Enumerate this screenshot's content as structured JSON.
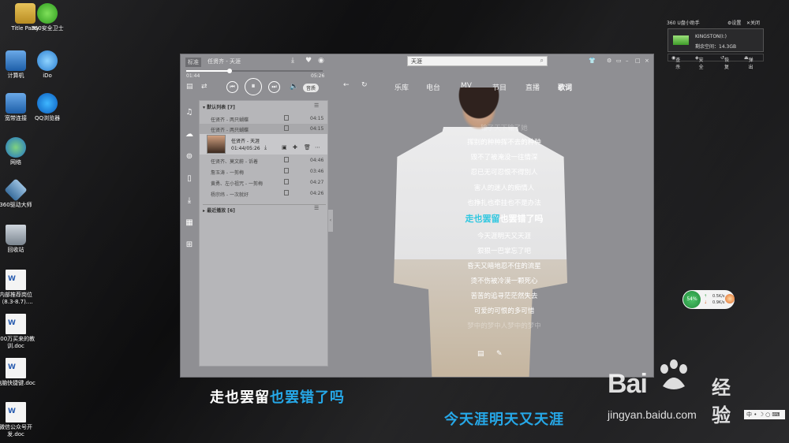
{
  "desktop": {
    "icons": [
      {
        "label": "Title Party"
      },
      {
        "label": "360安全卫士"
      },
      {
        "label": "计算机"
      },
      {
        "label": "iDo"
      },
      {
        "label": "宽带连接"
      },
      {
        "label": "QQ浏览器"
      },
      {
        "label": "网络"
      },
      {
        "label": "360驱动大师"
      },
      {
        "label": "回收站"
      },
      {
        "label": "内部推荐岗位（8.3-8.7)...."
      },
      {
        "label": "600万买来的教训.doc"
      },
      {
        "label": "电脑快捷键.doc"
      },
      {
        "label": "微信公众号开发.doc"
      }
    ]
  },
  "player": {
    "mode_label": "标准",
    "now_playing": "任贤齐 - 天涯",
    "search_value": "天涯",
    "time_elapsed": "01:44",
    "time_total": "05:26",
    "progress": 0.32,
    "quality_label": "音质",
    "nav": [
      "乐库",
      "电台",
      "MV",
      "节目",
      "直播",
      "歌词"
    ],
    "active_nav": "歌词"
  },
  "playlist": {
    "default_header": "默认列表 [7]",
    "recent_header": "最近播放 [6]",
    "rows": [
      {
        "name": "任贤齐 - 两只蝴蝶",
        "duration": "04:15"
      },
      {
        "name": "任贤齐 - 两只蝴蝶",
        "duration": "04:15"
      },
      {
        "name": "任贤齐、莫文蔚 - 诉着",
        "duration": "04:46"
      },
      {
        "name": "詹玉涛 - 一剪梅",
        "duration": "03:46"
      },
      {
        "name": "黄勇、左小祖咒 - 一剪梅",
        "duration": "04:27"
      },
      {
        "name": "杨宗纬 - 一次就好",
        "duration": "04:26"
      }
    ],
    "current": {
      "name": "任贤齐 - 天涯",
      "time": "01:44/05:26"
    }
  },
  "lyrics": {
    "lines": [
      {
        "text": "输了天下输了她",
        "state": "dim"
      },
      {
        "text": "挥别的种种挥不去的种种",
        "state": "normal"
      },
      {
        "text": "毁不了被淹没一往情深",
        "state": "normal"
      },
      {
        "text": "忍已无可忍恨不得別人",
        "state": "normal"
      },
      {
        "text": "害人的迷人的痴情人",
        "state": "normal"
      },
      {
        "text": "也挣扎也牵挂也不是办法",
        "state": "normal"
      }
    ],
    "current_played": "走也罢留",
    "current_rest": "也罢错了吗",
    "after": [
      {
        "text": "今天涯明天又天涯"
      },
      {
        "text": "狠狠一巴掌忘了吧"
      },
      {
        "text": "昏天又暗地忍不住的流星"
      },
      {
        "text": "烫不伤被冷漠一颗死心"
      },
      {
        "text": "苦苦的追寻茫茫然失去"
      },
      {
        "text": "可爱的可恨的多可惜"
      },
      {
        "text": "梦中的梦中人梦中的梦中",
        "state": "dim"
      }
    ]
  },
  "desktop_lyrics": {
    "line1_played": "走也罢留",
    "line1_rest": "也罢错了吗",
    "line2": "今天涯明天又天涯"
  },
  "usb_widget": {
    "title": "360 U盘小助手",
    "settings": "设置",
    "close": "关闭",
    "drive_name": "KINGSTON(I:)",
    "free_space": "剩余空间：14.3GB",
    "actions": [
      "查杀",
      "安全",
      "恢复",
      "弹出"
    ]
  },
  "net_widget": {
    "percent": "54%",
    "up": "0.5K/s",
    "down": "0.9K/s"
  },
  "watermark": {
    "brand_left": "Bai",
    "brand_right": "经验",
    "url": "jingyan.baidu.com"
  },
  "ime": {
    "label": "中"
  },
  "colors": {
    "lyric_highlight": "#2ec7e0",
    "desktop_lyric_blue": "#26a8e8"
  }
}
